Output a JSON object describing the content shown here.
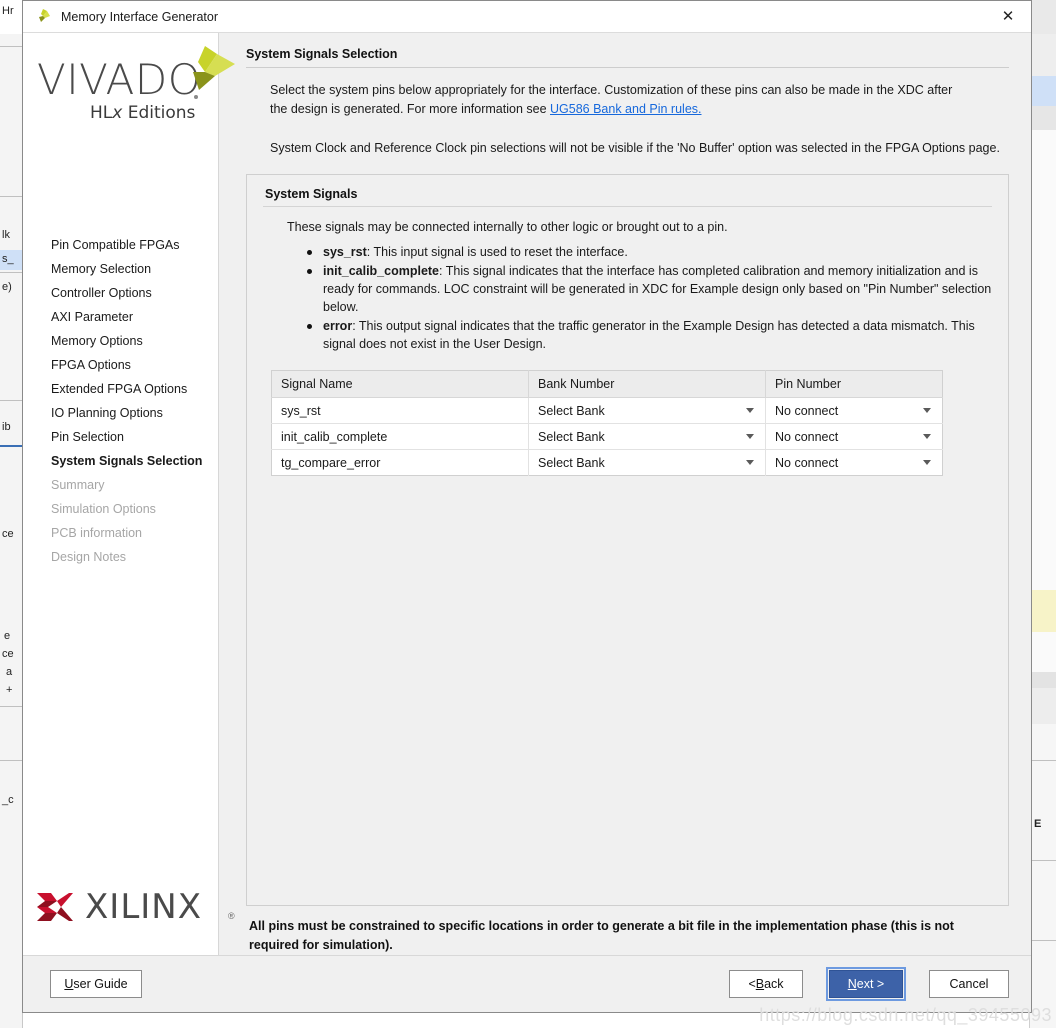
{
  "window": {
    "title": "Memory Interface Generator",
    "close_label": "✕",
    "app_icon": "vivado-pinwheel-icon"
  },
  "sidebar": {
    "logo": {
      "word": "VIVADO",
      "subtitle_prefix": "HL",
      "subtitle_italic": "x",
      "subtitle_suffix": " Editions",
      "mark": "vivado-pinwheel-icon"
    },
    "items": [
      {
        "label": "Pin Compatible FPGAs",
        "state": "normal"
      },
      {
        "label": "Memory Selection",
        "state": "normal"
      },
      {
        "label": "Controller Options",
        "state": "normal"
      },
      {
        "label": "AXI Parameter",
        "state": "normal"
      },
      {
        "label": "Memory Options",
        "state": "normal"
      },
      {
        "label": "FPGA Options",
        "state": "normal"
      },
      {
        "label": "Extended FPGA Options",
        "state": "normal"
      },
      {
        "label": "IO Planning Options",
        "state": "normal"
      },
      {
        "label": "Pin Selection",
        "state": "normal"
      },
      {
        "label": "System Signals Selection",
        "state": "active"
      },
      {
        "label": "Summary",
        "state": "disabled"
      },
      {
        "label": "Simulation Options",
        "state": "disabled"
      },
      {
        "label": "PCB information",
        "state": "disabled"
      },
      {
        "label": "Design Notes",
        "state": "disabled"
      }
    ],
    "footer_logo": {
      "word": "XILINX",
      "registered": "®",
      "mark": "xilinx-x-icon"
    }
  },
  "main": {
    "page_title": "System Signals Selection",
    "intro_part1": "Select the system pins below appropriately for the interface. Customization of these pins can also be made in the XDC after the design is generated. For more information see ",
    "intro_link": "UG586 Bank and Pin rules.",
    "intro_note": "System Clock and Reference Clock pin selections will not be visible if the 'No Buffer' option was selected in the FPGA Options page.",
    "group": {
      "title": "System Signals",
      "lead": "These signals may be connected internally to other logic or brought out to a pin.",
      "bullets": [
        {
          "term": "sys_rst",
          "text": ": This input signal is used to reset the interface."
        },
        {
          "term": "init_calib_complete",
          "text": ": This signal indicates that the interface has completed calibration and memory initialization and is ready for commands. LOC constraint will be generated in XDC for Example design only based on \"Pin Number\" selection below."
        },
        {
          "term": "error",
          "text": ": This output signal indicates that the traffic generator in the Example Design has detected a data mismatch. This signal does not exist in the User Design."
        }
      ],
      "table": {
        "columns": [
          "Signal Name",
          "Bank Number",
          "Pin Number"
        ],
        "rows": [
          {
            "signal": "sys_rst",
            "bank": "Select Bank",
            "pin": "No connect"
          },
          {
            "signal": "init_calib_complete",
            "bank": "Select Bank",
            "pin": "No connect"
          },
          {
            "signal": "tg_compare_error",
            "bank": "Select Bank",
            "pin": "No connect"
          }
        ]
      }
    },
    "footnote": "All pins must be constrained to specific locations in order to generate a bit file in the implementation phase (this is not required for simulation)."
  },
  "buttons": {
    "user_guide": {
      "mnemonic": "U",
      "rest": "ser Guide"
    },
    "back": {
      "prefix": "< ",
      "mnemonic": "B",
      "rest": "ack"
    },
    "next": {
      "mnemonic": "N",
      "rest": "ext >"
    },
    "cancel": {
      "label": "Cancel"
    }
  },
  "watermark": "https://blog.csdn.net/qq_39455093",
  "colors": {
    "accent_blue": "#3d62a8",
    "focus_ring": "#6d9ae0",
    "link_blue": "#1668dc",
    "vivado_green": "#c8d32a",
    "vivado_olive": "#8a931a",
    "xilinx_red": "#c8102e",
    "xilinx_dark_red": "#8f1020",
    "panel_bg": "#f0f0f0",
    "table_header_bg": "#ececec"
  },
  "background": {
    "left_fragments": [
      "lk",
      "s_",
      "e)",
      "ib",
      "ce",
      "e",
      "ce",
      "a",
      "+",
      "_c"
    ],
    "right_fragments": [
      "E"
    ]
  }
}
